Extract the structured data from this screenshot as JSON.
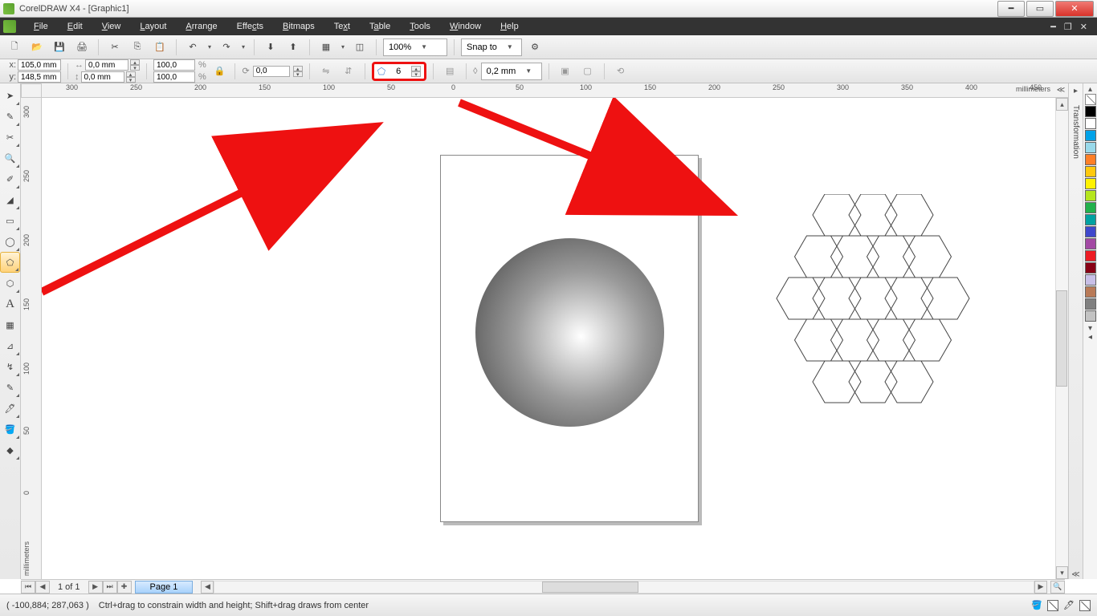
{
  "title": "CorelDRAW X4 - [Graphic1]",
  "menus": [
    "File",
    "Edit",
    "View",
    "Layout",
    "Arrange",
    "Effects",
    "Bitmaps",
    "Text",
    "Table",
    "Tools",
    "Window",
    "Help"
  ],
  "toolbar": {
    "zoom": "100%",
    "snap_label": "Snap to"
  },
  "propbar": {
    "x_label": "x:",
    "y_label": "y:",
    "x": "105,0 mm",
    "y": "148,5 mm",
    "w": "0,0 mm",
    "h": "0,0 mm",
    "sx": "100,0",
    "sy": "100,0",
    "rot": "0,0",
    "sides": "6",
    "outline": "0,2 mm"
  },
  "ruler": {
    "unit": "millimeters",
    "h_ticks": [
      "300",
      "250",
      "200",
      "150",
      "100",
      "50",
      "0",
      "50",
      "100",
      "150",
      "200",
      "250",
      "300",
      "350",
      "400",
      "450"
    ],
    "v_ticks": [
      "300",
      "250",
      "200",
      "150",
      "100",
      "50",
      "0"
    ]
  },
  "right_dock": {
    "tab1": "Transformation"
  },
  "palette": [
    "#000000",
    "#ffffff",
    "#00a2e8",
    "#99d9ea",
    "#ff7f27",
    "#ffc90e",
    "#fff200",
    "#b5e61d",
    "#22b14c",
    "#00a2a2",
    "#3f48cc",
    "#a349a4",
    "#ed1c24",
    "#880015",
    "#c8bfe7",
    "#b97a57",
    "#808080",
    "#c3c3c3"
  ],
  "pagenav": {
    "count": "1 of 1",
    "tab": "Page 1"
  },
  "status": {
    "coords": "( -100,884; 287,063 )",
    "hint": "Ctrl+drag to constrain width and height; Shift+drag draws from center"
  }
}
